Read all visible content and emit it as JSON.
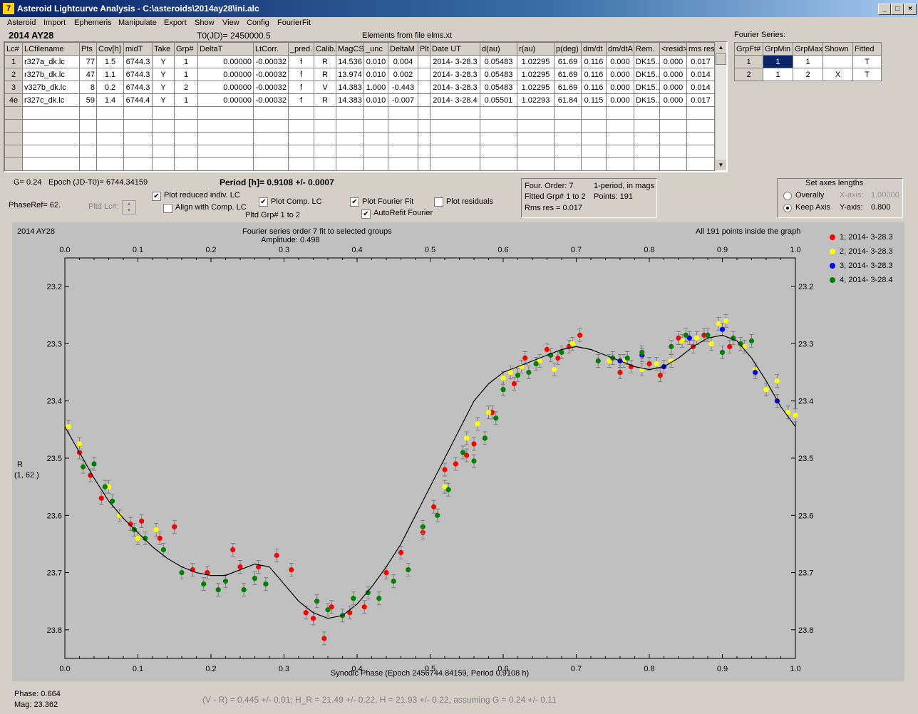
{
  "window": {
    "title": "Asteroid Lightcurve Analysis - C:\\asteroids\\2014ay28\\ini.alc",
    "icon": "app-icon"
  },
  "menu": [
    "Asteroid",
    "Import",
    "Ephemeris",
    "Manipulate",
    "Export",
    "Show",
    "View",
    "Config",
    "FourierFit"
  ],
  "header": {
    "asteroid": "2014 AY28",
    "t0": "T0(JD)= 2450000.5",
    "elements": "Elements from file elms.xt"
  },
  "lc_table": {
    "columns": [
      "Lc#",
      "LCfilename",
      "Pts",
      "Cov[h]",
      "midT",
      "Take",
      "Grp#",
      "DeltaT",
      "LtCorr.",
      "_pred.",
      "Calib.",
      "MagCS",
      "_unc",
      "DeltaM",
      "Plt",
      "Date UT",
      "d(au)",
      "r(au)",
      "p(deg)",
      "dm/dt",
      "dm/dtA",
      "Rem.",
      "<resid>",
      "rms res"
    ],
    "rows": [
      [
        "1",
        "r327a_dk.lc",
        "77",
        "1.5",
        "6744.3",
        "Y",
        "1",
        "0.00000",
        "-0.00032",
        "f",
        "R",
        "14.536",
        "0.010",
        "0.004",
        "",
        "2014- 3-28.3",
        "0.05483",
        "1.02295",
        "61.69",
        "0.116",
        "0.000",
        "DK15...",
        "0.000",
        "0.017"
      ],
      [
        "2",
        "r327b_dk.lc",
        "47",
        "1.1",
        "6744.3",
        "Y",
        "1",
        "0.00000",
        "-0.00032",
        "f",
        "R",
        "13.974",
        "0.010",
        "0.002",
        "",
        "2014- 3-28.3",
        "0.05483",
        "1.02295",
        "61.69",
        "0.116",
        "0.000",
        "DK15...",
        "0.000",
        "0.014"
      ],
      [
        "3",
        "v327b_dk.lc",
        "8",
        "0.2",
        "6744.3",
        "Y",
        "2",
        "0.00000",
        "-0.00032",
        "f",
        "V",
        "14.383",
        "1.000",
        "-0.443",
        "",
        "2014- 3-28.3",
        "0.05483",
        "1.02295",
        "61.69",
        "0.116",
        "0.000",
        "DK15...",
        "0.000",
        "0.014"
      ],
      [
        "4e",
        "r327c_dk.lc",
        "59",
        "1.4",
        "6744.4",
        "Y",
        "1",
        "0.00000",
        "-0.00032",
        "f",
        "R",
        "14.383",
        "0.010",
        "-0.007",
        "",
        "2014- 3-28.4",
        "0.05501",
        "1.02293",
        "61.84",
        "0.115",
        "0.000",
        "DK15...",
        "0.000",
        "0.017"
      ]
    ],
    "empty_rows": 5
  },
  "fourier_series": {
    "title": "Fourier Series:",
    "columns": [
      "GrpFt#",
      "GrpMin",
      "GrpMax",
      "Shown",
      "Fitted"
    ],
    "rows": [
      [
        "1",
        "1",
        "1",
        "",
        "T"
      ],
      [
        "2",
        "1",
        "2",
        "X",
        "T"
      ]
    ]
  },
  "controls": {
    "g": "G= 0.24",
    "epoch": "Epoch (JD-T0)= 6744.34159",
    "period": "Period [h]= 0.9108 +/- 0.0007",
    "phaseref": "PhaseRef= 62.",
    "pltd_lc": "Pltd Lc#:",
    "plot_reduced": "Plot reduced indiv. LC",
    "align": "Align with Comp. LC",
    "plot_comp": "Plot Comp. LC",
    "pltd_grp": "Pltd Grp#  1   to   2",
    "plot_fourier": "Plot Fourier Fit",
    "autorefit": "AutoRefit Fourier",
    "plot_residuals": "Plot residuals"
  },
  "info": {
    "order": "Four. Order:  7",
    "period_mode": "1-period, in mags",
    "fitted": "Fitted Grp# 1 to 2",
    "points": "Points: 191",
    "rms": "Rms res      = 0.017"
  },
  "axes_box": {
    "title": "Set axes lengths",
    "overall": "Overally",
    "keep": "Keep Axis",
    "xaxis_label": "X-axis:",
    "xaxis_val": "1.00000",
    "yaxis_label": "Y-axis:",
    "yaxis_val": "0.800"
  },
  "plot": {
    "name": "2014 AY28",
    "title1": "Fourier series order 7 fit to selected groups",
    "title2": "Amplitude: 0.498",
    "status": "All 191 points inside the graph",
    "ylabel1": "R",
    "ylabel2": "(1, 62.)",
    "xlabel": "Synodic Phase (Epoch 2456744.84159, Period 0.9108 h)"
  },
  "chart_data": {
    "type": "scatter",
    "xlim": [
      0.0,
      1.0
    ],
    "ylim": [
      23.85,
      23.15
    ],
    "x_ticks": [
      "0.0",
      "0.1",
      "0.2",
      "0.3",
      "0.4",
      "0.5",
      "0.6",
      "0.7",
      "0.8",
      "0.9",
      "1.0"
    ],
    "y_ticks": [
      "23.2",
      "23.3",
      "23.4",
      "23.5",
      "23.6",
      "23.7",
      "23.8",
      "23.9"
    ],
    "y_tick_values": [
      23.2,
      23.3,
      23.4,
      23.5,
      23.6,
      23.7,
      23.8,
      23.9
    ],
    "grid": false,
    "legend_position": "right",
    "fit_curve": {
      "x": [
        0.0,
        0.02,
        0.04,
        0.06,
        0.08,
        0.1,
        0.12,
        0.14,
        0.16,
        0.18,
        0.2,
        0.22,
        0.24,
        0.26,
        0.28,
        0.3,
        0.32,
        0.34,
        0.36,
        0.38,
        0.4,
        0.42,
        0.44,
        0.46,
        0.48,
        0.5,
        0.52,
        0.54,
        0.56,
        0.58,
        0.6,
        0.62,
        0.64,
        0.66,
        0.68,
        0.7,
        0.72,
        0.74,
        0.76,
        0.78,
        0.8,
        0.82,
        0.84,
        0.86,
        0.88,
        0.9,
        0.92,
        0.94,
        0.96,
        0.98,
        1.0
      ],
      "y": [
        23.445,
        23.49,
        23.535,
        23.575,
        23.605,
        23.63,
        23.655,
        23.675,
        23.69,
        23.7,
        23.705,
        23.705,
        23.695,
        23.685,
        23.69,
        23.72,
        23.75,
        23.77,
        23.78,
        23.775,
        23.755,
        23.725,
        23.69,
        23.65,
        23.6,
        23.55,
        23.5,
        23.45,
        23.4,
        23.37,
        23.35,
        23.34,
        23.33,
        23.32,
        23.31,
        23.305,
        23.31,
        23.32,
        23.33,
        23.34,
        23.345,
        23.34,
        23.325,
        23.305,
        23.29,
        23.285,
        23.295,
        23.325,
        23.365,
        23.41,
        23.445
      ]
    },
    "series": [
      {
        "name": "1; 2014- 3-28.3",
        "color": "#ff0000",
        "x": [
          0.02,
          0.035,
          0.05,
          0.09,
          0.105,
          0.13,
          0.15,
          0.175,
          0.195,
          0.23,
          0.24,
          0.265,
          0.29,
          0.31,
          0.33,
          0.34,
          0.355,
          0.365,
          0.39,
          0.41,
          0.44,
          0.46,
          0.49,
          0.505,
          0.52,
          0.535,
          0.55,
          0.56,
          0.585,
          0.615,
          0.63,
          0.66,
          0.675,
          0.69,
          0.705,
          0.76,
          0.775,
          0.8,
          0.815,
          0.84,
          0.86,
          0.875,
          0.91
        ],
        "y": [
          23.49,
          23.53,
          23.57,
          23.615,
          23.61,
          23.64,
          23.62,
          23.695,
          23.7,
          23.66,
          23.69,
          23.69,
          23.67,
          23.695,
          23.77,
          23.78,
          23.815,
          23.76,
          23.77,
          23.76,
          23.7,
          23.665,
          23.63,
          23.585,
          23.52,
          23.51,
          23.495,
          23.475,
          23.42,
          23.37,
          23.325,
          23.31,
          23.325,
          23.305,
          23.285,
          23.35,
          23.34,
          23.335,
          23.355,
          23.29,
          23.305,
          23.285,
          23.305
        ]
      },
      {
        "name": "2; 2014- 3-28.3",
        "color": "#ffff00",
        "x": [
          0.005,
          0.02,
          0.06,
          0.075,
          0.1,
          0.125,
          0.52,
          0.55,
          0.565,
          0.58,
          0.6,
          0.61,
          0.625,
          0.65,
          0.67,
          0.695,
          0.745,
          0.765,
          0.79,
          0.81,
          0.83,
          0.845,
          0.865,
          0.885,
          0.895,
          0.905,
          0.93,
          0.945,
          0.96,
          0.975,
          0.99,
          1.0
        ],
        "y": [
          23.445,
          23.475,
          23.55,
          23.6,
          23.64,
          23.625,
          23.55,
          23.465,
          23.44,
          23.42,
          23.36,
          23.35,
          23.34,
          23.33,
          23.345,
          23.3,
          23.33,
          23.33,
          23.345,
          23.335,
          23.33,
          23.295,
          23.29,
          23.3,
          23.265,
          23.26,
          23.305,
          23.345,
          23.38,
          23.365,
          23.42,
          23.425
        ]
      },
      {
        "name": "3; 2014- 3-28.3",
        "color": "#0000ff",
        "x": [
          0.76,
          0.79,
          0.82,
          0.855,
          0.9,
          0.945,
          0.975
        ],
        "y": [
          23.33,
          23.32,
          23.34,
          23.29,
          23.275,
          23.35,
          23.4
        ]
      },
      {
        "name": "4; 2014- 3-28.4",
        "color": "#008000",
        "x": [
          0.025,
          0.04,
          0.055,
          0.065,
          0.095,
          0.11,
          0.135,
          0.16,
          0.19,
          0.21,
          0.22,
          0.245,
          0.26,
          0.275,
          0.345,
          0.36,
          0.38,
          0.395,
          0.415,
          0.43,
          0.45,
          0.47,
          0.49,
          0.51,
          0.525,
          0.545,
          0.56,
          0.575,
          0.59,
          0.6,
          0.62,
          0.635,
          0.645,
          0.665,
          0.68,
          0.73,
          0.75,
          0.77,
          0.79,
          0.83,
          0.85,
          0.88,
          0.9,
          0.915,
          0.925,
          0.94
        ],
        "y": [
          23.515,
          23.51,
          23.55,
          23.575,
          23.625,
          23.64,
          23.66,
          23.7,
          23.72,
          23.73,
          23.715,
          23.73,
          23.71,
          23.72,
          23.75,
          23.765,
          23.775,
          23.745,
          23.735,
          23.745,
          23.715,
          23.695,
          23.62,
          23.6,
          23.555,
          23.49,
          23.505,
          23.465,
          23.43,
          23.38,
          23.355,
          23.35,
          23.335,
          23.32,
          23.315,
          23.33,
          23.325,
          23.325,
          23.315,
          23.305,
          23.285,
          23.285,
          23.315,
          23.29,
          23.3,
          23.295
        ]
      }
    ]
  },
  "footer": {
    "phase": "Phase:  0.664",
    "mag": "Mag:    23.362",
    "result": "(V - R) = 0.445 +/- 0.01; H_R = 21.49 +/- 0.22, H = 21.93 +/- 0.22, assuming G = 0.24 +/- 0.11"
  }
}
